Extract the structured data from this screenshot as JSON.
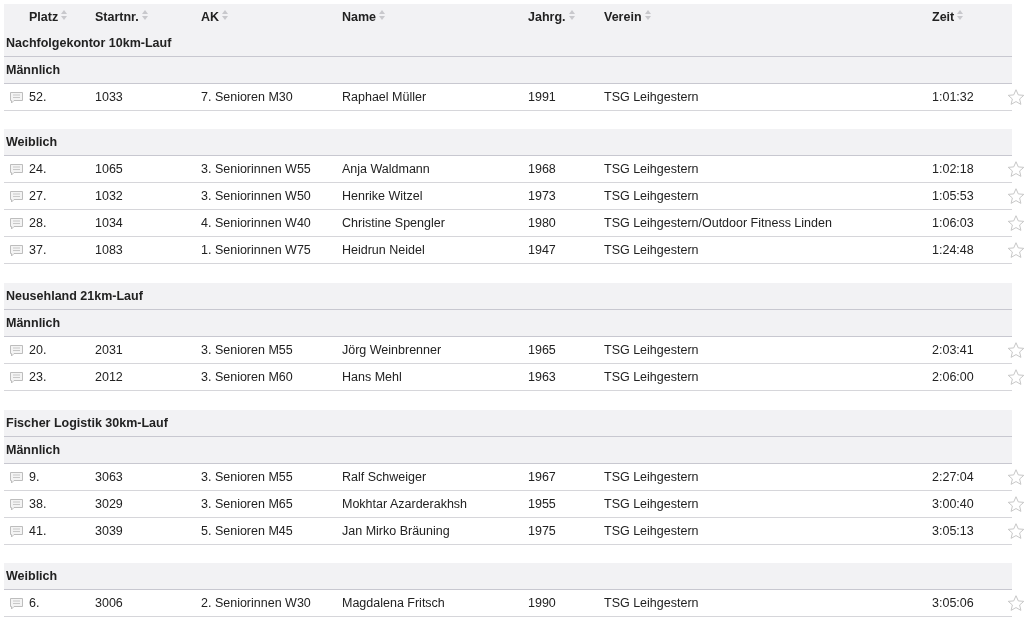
{
  "columns": [
    "Platz",
    "Startnr.",
    "AK",
    "Name",
    "Jahrg.",
    "Verein",
    "Zeit"
  ],
  "events": [
    {
      "title": "Nachfolgekontor 10km-Lauf",
      "groups": [
        {
          "label": "Männlich",
          "rows": [
            {
              "platz": "52.",
              "startnr": "1033",
              "ak": "7. Senioren M30",
              "name": "Raphael Müller",
              "jahrg": "1991",
              "verein": "TSG Leihgestern",
              "zeit": "1:01:32"
            }
          ]
        },
        {
          "label": "Weiblich",
          "rows": [
            {
              "platz": "24.",
              "startnr": "1065",
              "ak": "3. Seniorinnen W55",
              "name": "Anja Waldmann",
              "jahrg": "1968",
              "verein": "TSG Leihgestern",
              "zeit": "1:02:18"
            },
            {
              "platz": "27.",
              "startnr": "1032",
              "ak": "3. Seniorinnen W50",
              "name": "Henrike Witzel",
              "jahrg": "1973",
              "verein": "TSG Leihgestern",
              "zeit": "1:05:53"
            },
            {
              "platz": "28.",
              "startnr": "1034",
              "ak": "4. Seniorinnen W40",
              "name": "Christine Spengler",
              "jahrg": "1980",
              "verein": "TSG Leihgestern/Outdoor Fitness Linden",
              "zeit": "1:06:03"
            },
            {
              "platz": "37.",
              "startnr": "1083",
              "ak": "1. Seniorinnen W75",
              "name": "Heidrun Neidel",
              "jahrg": "1947",
              "verein": "TSG Leihgestern",
              "zeit": "1:24:48"
            }
          ]
        }
      ]
    },
    {
      "title": "Neusehland 21km-Lauf",
      "groups": [
        {
          "label": "Männlich",
          "rows": [
            {
              "platz": "20.",
              "startnr": "2031",
              "ak": "3. Senioren M55",
              "name": "Jörg Weinbrenner",
              "jahrg": "1965",
              "verein": "TSG Leihgestern",
              "zeit": "2:03:41"
            },
            {
              "platz": "23.",
              "startnr": "2012",
              "ak": "3. Senioren M60",
              "name": "Hans Mehl",
              "jahrg": "1963",
              "verein": "TSG Leihgestern",
              "zeit": "2:06:00"
            }
          ]
        }
      ]
    },
    {
      "title": "Fischer Logistik 30km-Lauf",
      "groups": [
        {
          "label": "Männlich",
          "rows": [
            {
              "platz": "9.",
              "startnr": "3063",
              "ak": "3. Senioren M55",
              "name": "Ralf Schweiger",
              "jahrg": "1967",
              "verein": "TSG Leihgestern",
              "zeit": "2:27:04"
            },
            {
              "platz": "38.",
              "startnr": "3029",
              "ak": "3. Senioren M65",
              "name": "Mokhtar Azarderakhsh",
              "jahrg": "1955",
              "verein": "TSG Leihgestern",
              "zeit": "3:00:40"
            },
            {
              "platz": "41.",
              "startnr": "3039",
              "ak": "5. Senioren M45",
              "name": "Jan Mirko Bräuning",
              "jahrg": "1975",
              "verein": "TSG Leihgestern",
              "zeit": "3:05:13"
            }
          ]
        },
        {
          "label": "Weiblich",
          "rows": [
            {
              "platz": "6.",
              "startnr": "3006",
              "ak": "2. Seniorinnen W30",
              "name": "Magdalena Fritsch",
              "jahrg": "1990",
              "verein": "TSG Leihgestern",
              "zeit": "3:05:06"
            }
          ]
        }
      ]
    }
  ]
}
